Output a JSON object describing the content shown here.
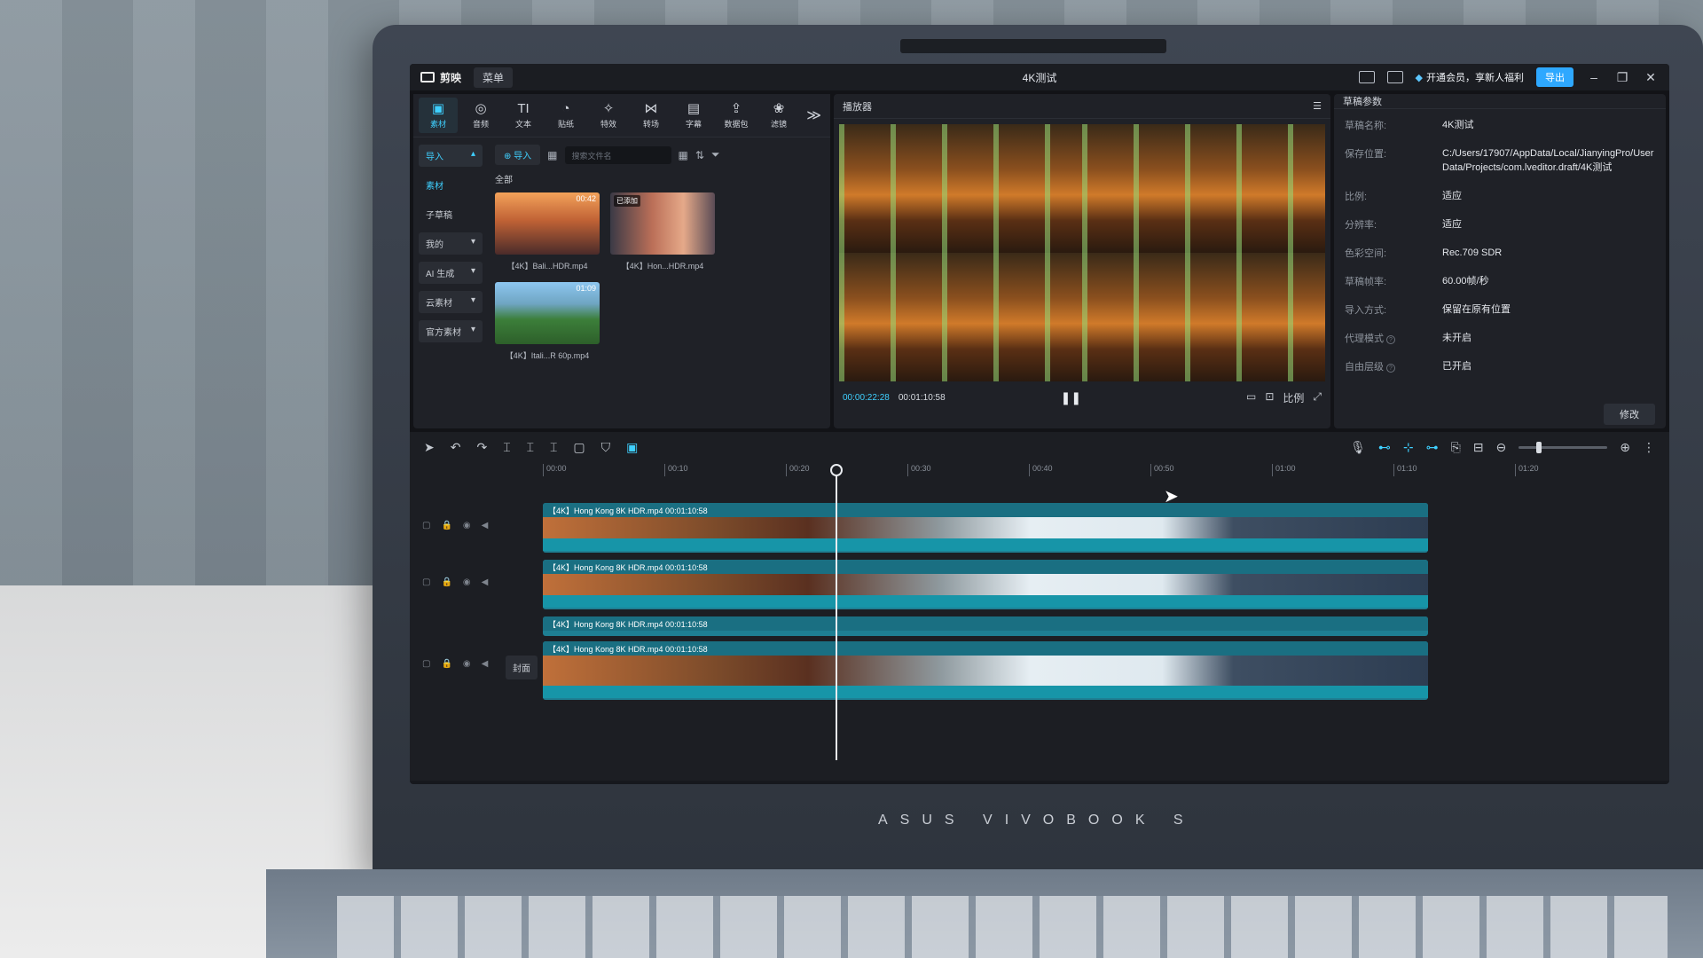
{
  "app": {
    "logo_text": "剪映",
    "menu_label": "菜单",
    "window_title": "4K测试",
    "vip_text": "开通会员，享新人福利",
    "export_label": "导出",
    "minimize": "–",
    "restore": "❐",
    "close": "✕"
  },
  "toolbar_tabs": [
    {
      "icon": "▣",
      "label": "素材",
      "active": true
    },
    {
      "icon": "◎",
      "label": "音频"
    },
    {
      "icon": "TI",
      "label": "文本"
    },
    {
      "icon": "◔",
      "label": "贴纸"
    },
    {
      "icon": "✧",
      "label": "特效"
    },
    {
      "icon": "⋈",
      "label": "转场"
    },
    {
      "icon": "▤",
      "label": "字幕"
    },
    {
      "icon": "⇪",
      "label": "数据包"
    },
    {
      "icon": "❀",
      "label": "滤镜"
    }
  ],
  "toolbar_more": "≫",
  "media": {
    "side_items": [
      {
        "label": "导入",
        "style": "active",
        "chevron": "▴"
      },
      {
        "label": "素材",
        "style": "plain-accent"
      },
      {
        "label": "子草稿",
        "style": "plain"
      },
      {
        "label": "我的",
        "style": "box",
        "chevron": "▾"
      },
      {
        "label": "AI 生成",
        "style": "box",
        "chevron": "▾"
      },
      {
        "label": "云素材",
        "style": "box",
        "chevron": "▾"
      },
      {
        "label": "官方素材",
        "style": "box",
        "chevron": "▾"
      }
    ],
    "import_label": "导入",
    "search_placeholder": "搜索文件名",
    "all_label": "全部",
    "clips": [
      {
        "name": "【4K】Bali...HDR.mp4",
        "duration": "00:42",
        "badge": ""
      },
      {
        "name": "【4K】Hon...HDR.mp4",
        "duration": "",
        "badge": "已添加"
      },
      {
        "name": "【4K】Itali...R 60p.mp4",
        "duration": "01:09",
        "badge": ""
      }
    ]
  },
  "player": {
    "title": "播放器",
    "menu_icon": "☰",
    "time_current": "00:00:22:28",
    "time_total": "00:01:10:58",
    "play_icon": "❚❚",
    "ratio_label": "比例"
  },
  "properties": {
    "title": "草稿参数",
    "rows": [
      {
        "key": "草稿名称:",
        "value": "4K测试"
      },
      {
        "key": "保存位置:",
        "value": "C:/Users/17907/AppData/Local/JianyingPro/User Data/Projects/com.lveditor.draft/4K测试"
      },
      {
        "key": "比例:",
        "value": "适应"
      },
      {
        "key": "分辨率:",
        "value": "适应"
      },
      {
        "key": "色彩空间:",
        "value": "Rec.709 SDR"
      },
      {
        "key": "草稿帧率:",
        "value": "60.00帧/秒"
      },
      {
        "key": "导入方式:",
        "value": "保留在原有位置"
      },
      {
        "key": "代理模式",
        "value": "未开启"
      },
      {
        "key": "自由层级",
        "value": "已开启"
      }
    ],
    "modify_label": "修改"
  },
  "timeline": {
    "ticks": [
      "00:00",
      "00:10",
      "00:20",
      "00:30",
      "00:40",
      "00:50",
      "01:00",
      "01:10",
      "01:20"
    ],
    "clips": [
      "【4K】Hong Kong 8K HDR.mp4  00:01:10:58",
      "【4K】Hong Kong 8K HDR.mp4  00:01:10:58",
      "【4K】Hong Kong 8K HDR.mp4  00:01:10:58",
      "【4K】Hong Kong 8K HDR.mp4  00:01:10:58"
    ],
    "cover_label": "封面"
  },
  "laptop": {
    "brand": "ASUS VIVOBOOK S"
  },
  "colors": {
    "accent": "#3fd0ff",
    "clip": "#1e7f93",
    "export": "#2ea8ff"
  }
}
